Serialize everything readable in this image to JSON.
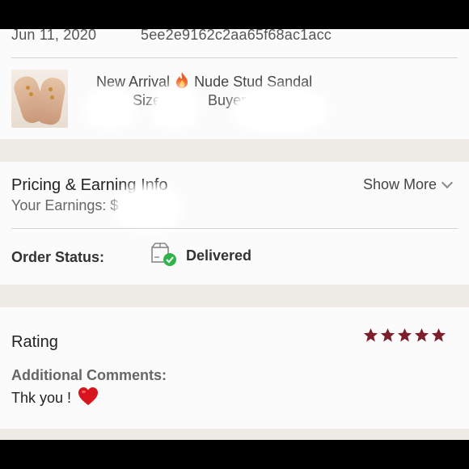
{
  "order": {
    "date": "Jun 11, 2020",
    "id": "5ee2e9162c2aa65f68ac1acc"
  },
  "product": {
    "title_before": "New Arrival",
    "title_after": "Nude Stud Sandal",
    "size_label": "Size:",
    "buyer_label": "Buyer:",
    "title_icon": "fire-icon"
  },
  "pricing": {
    "title": "Pricing & Earning Info",
    "show_more_label": "Show More",
    "earnings_label": "Your Earnings: $"
  },
  "status": {
    "label": "Order Status:",
    "value": "Delivered",
    "icon": "delivered-box-icon",
    "check_color": "#2fb34a"
  },
  "rating": {
    "title": "Rating",
    "stars": 5,
    "star_color": "#7a1f2b",
    "comments_label": "Additional Comments:",
    "comment_text": "Thk you !",
    "comment_icon": "heart-icon"
  }
}
